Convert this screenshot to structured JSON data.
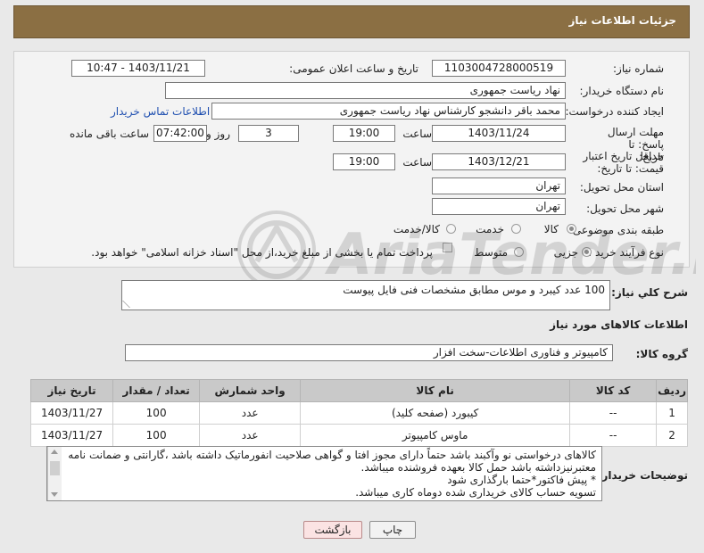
{
  "page": {
    "title": "جزئیات اطلاعات نیاز"
  },
  "form": {
    "need_number": {
      "label": "شماره نیاز:",
      "value": "1103004728000519"
    },
    "announce_datetime": {
      "label": "تاریخ و ساعت اعلان عمومی:",
      "value": "1403/11/21 - 10:47"
    },
    "buyer_org": {
      "label": "نام دستگاه خریدار:",
      "value": "نهاد ریاست جمهوری"
    },
    "requester": {
      "label": "ایجاد کننده درخواست:",
      "value": "محمد باقر دانشجو کارشناس نهاد ریاست جمهوری"
    },
    "contact_link": "اطلاعات تماس خریدار",
    "reply_deadline": {
      "label": "مهلت ارسال پاسخ: تا تاریخ:",
      "date": "1403/11/24",
      "time_label": "ساعت",
      "time": "19:00",
      "days": "3",
      "days_label": "روز و",
      "remaining": "07:42:00",
      "remaining_label": "ساعت باقی مانده"
    },
    "price_validity": {
      "label": "حداقل تاریخ اعتبار قیمت: تا تاریخ:",
      "date": "1403/12/21",
      "time_label": "ساعت",
      "time": "19:00"
    },
    "province": {
      "label": "استان محل تحویل:",
      "value": "تهران"
    },
    "city": {
      "label": "شهر محل تحویل:",
      "value": "تهران"
    },
    "category": {
      "label": "طبقه بندی موضوعی:",
      "options": [
        "کالا",
        "خدمت",
        "کالا/خدمت"
      ],
      "selected": "کالا"
    },
    "purchase_type": {
      "label": "نوع فرآیند خرید :",
      "options": [
        "جزیی",
        "متوسط"
      ],
      "selected": "جزیی",
      "payment_note": "پرداخت تمام یا بخشی از مبلغ خرید،از محل \"اسناد خزانه اسلامی\" خواهد بود."
    }
  },
  "description": {
    "label": "شرح کلي نياز:",
    "value": "100 عدد کیبرد و موس مطابق مشخصات فنی فایل پیوست"
  },
  "items_section": {
    "title": "اطلاعات کالاهای مورد نیاز",
    "group_label": "گروه کالا:",
    "group_value": "کامپیوتر و فناوری اطلاعات-سخت افزار",
    "columns": [
      "ردیف",
      "کد کالا",
      "نام کالا",
      "واحد شمارش",
      "تعداد / مقدار",
      "تاریخ نیاز"
    ],
    "rows": [
      {
        "row": "1",
        "code": "--",
        "name": "کیبورد (صفحه کلید)",
        "unit": "عدد",
        "qty": "100",
        "date": "1403/11/27"
      },
      {
        "row": "2",
        "code": "--",
        "name": "ماوس کامپیوتر",
        "unit": "عدد",
        "qty": "100",
        "date": "1403/11/27"
      }
    ]
  },
  "buyer_notes": {
    "label": "توضیحات خریدار:",
    "lines": [
      "کالاهای درخواستی نو وآکبند باشد حتماً دارای مجوز افتا و گواهی صلاحیت انفورماتیک داشته باشد ،گارانتی و ضمانت نامه",
      "معتبرنیزداشته باشد حمل کالا بعهده فروشنده میباشد.",
      "* پیش فاکتور*حتما بارگذاری شود",
      "تسویه حساب کالای خریداری شده دوماه کاری میباشد."
    ]
  },
  "buttons": {
    "print": "چاپ",
    "back": "بازگشت"
  },
  "watermark": {
    "text": "AriaTender.neT",
    "icon": "aria-logo-icon"
  }
}
